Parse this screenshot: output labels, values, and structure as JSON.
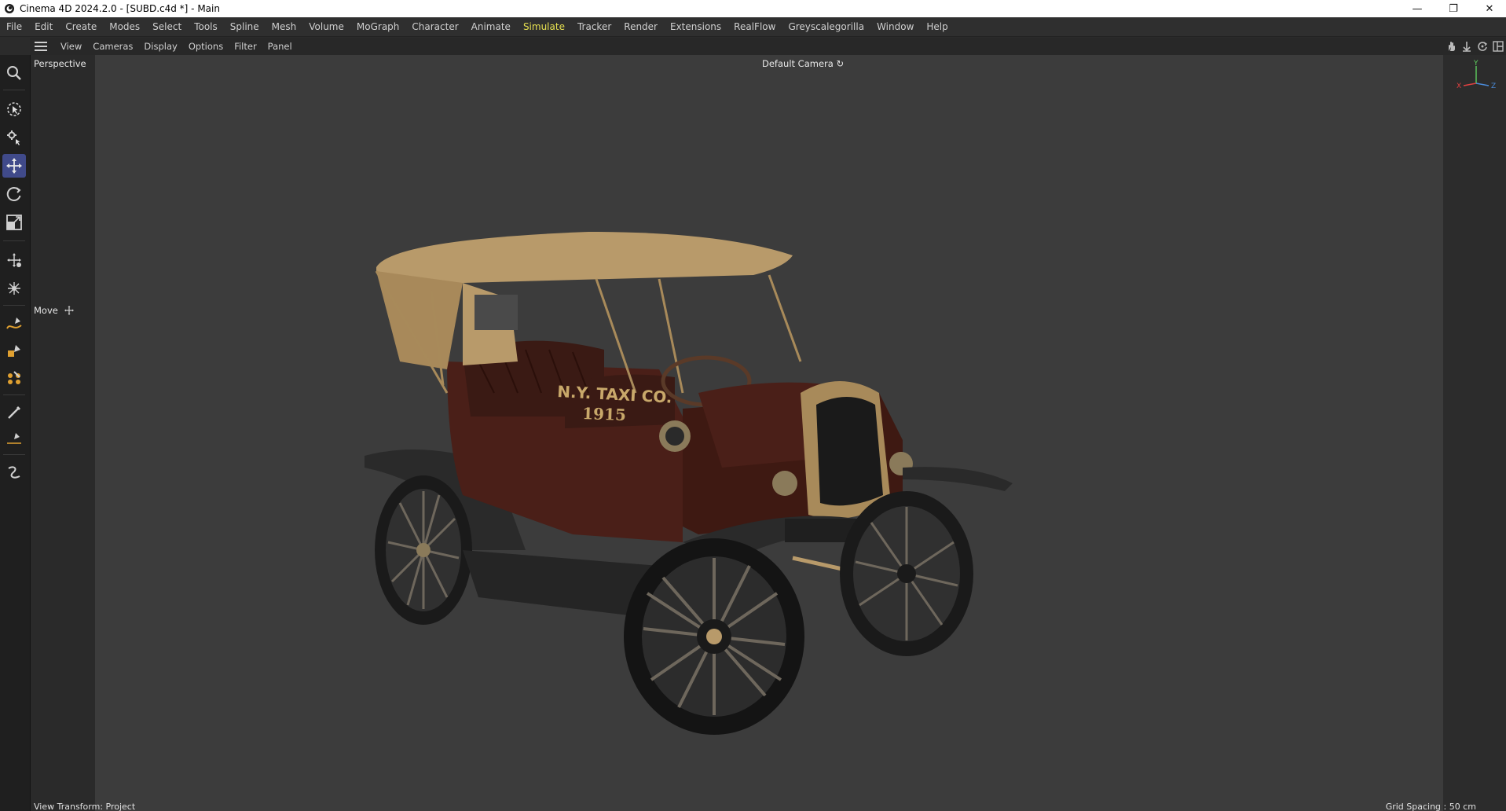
{
  "window": {
    "title": "Cinema 4D 2024.2.0 - [SUBD.c4d *] - Main",
    "minimize": "—",
    "restore": "❐",
    "close": "✕"
  },
  "menu": [
    "File",
    "Edit",
    "Create",
    "Modes",
    "Select",
    "Tools",
    "Spline",
    "Mesh",
    "Volume",
    "MoGraph",
    "Character",
    "Animate",
    "Simulate",
    "Tracker",
    "Render",
    "Extensions",
    "RealFlow",
    "Greyscalegorilla",
    "Window",
    "Help"
  ],
  "menu_active": "Simulate",
  "viewmenu": [
    "View",
    "Cameras",
    "Display",
    "Options",
    "Filter",
    "Panel"
  ],
  "viewport": {
    "projection": "Perspective",
    "camera": "Default Camera",
    "camera_icon": "↻",
    "active_tool": "Move",
    "view_transform": "View Transform: Project",
    "grid_spacing": "Grid Spacing : 50 cm",
    "axis": {
      "x": "X",
      "y": "Y",
      "z": "Z"
    }
  },
  "car_text": {
    "line1": "N.Y. TAXI CO.",
    "line2": "1915"
  },
  "colors": {
    "accent": "#404a8a",
    "menu_active": "#e6e050",
    "viewport_bg": "#3c3c3c",
    "car_body": "#4a1f18",
    "car_roof": "#b89a6a",
    "car_brass": "#a88a5a"
  }
}
